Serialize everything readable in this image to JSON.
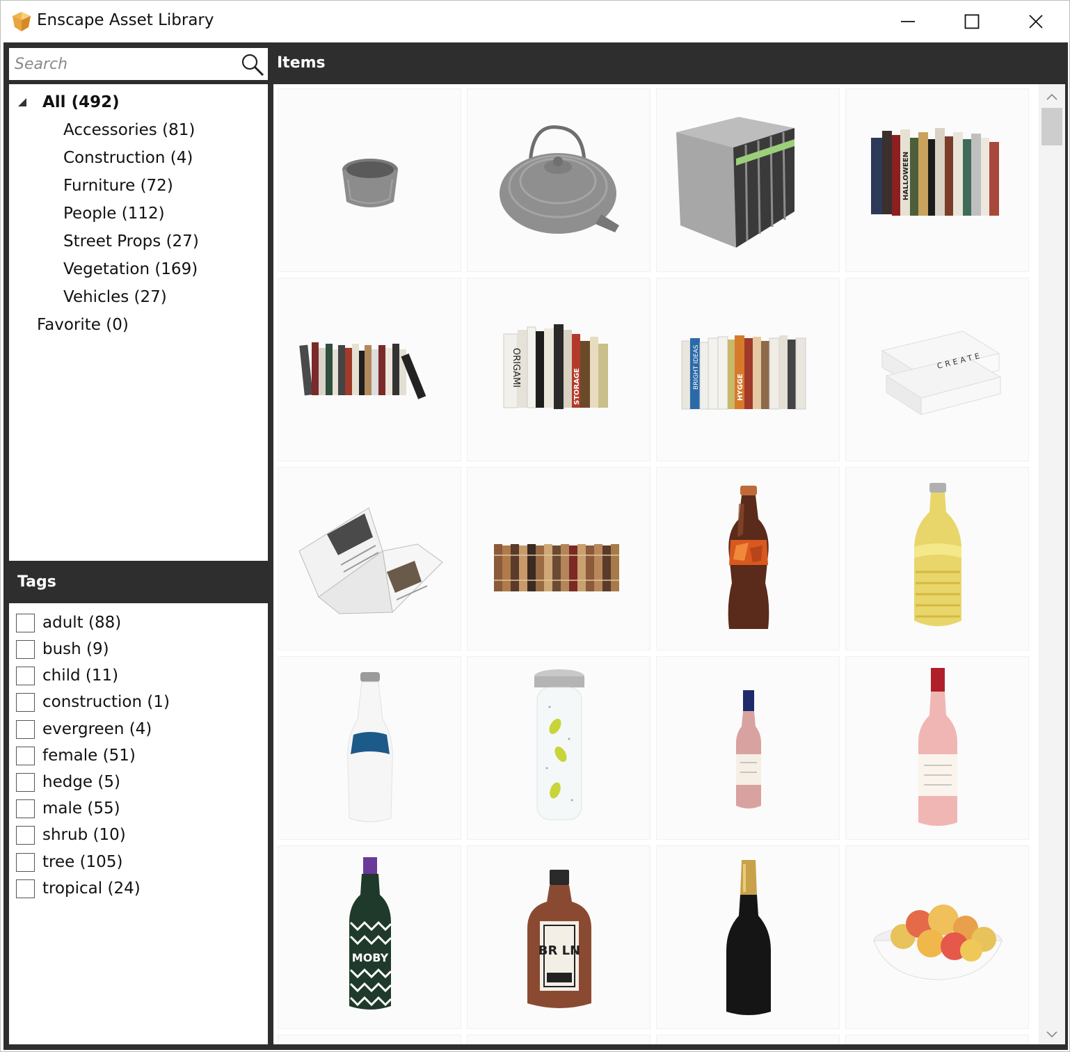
{
  "window": {
    "title": "Enscape Asset Library"
  },
  "search": {
    "placeholder": "Search"
  },
  "tree": {
    "root_label": "All (492)",
    "categories": [
      "Accessories (81)",
      "Construction (4)",
      "Furniture (72)",
      "People (112)",
      "Street Props (27)",
      "Vegetation (169)",
      "Vehicles (27)"
    ],
    "favorite_label": "Favorite (0)"
  },
  "tags": {
    "header": "Tags",
    "items": [
      "adult (88)",
      "bush (9)",
      "child (11)",
      "construction (1)",
      "evergreen (4)",
      "female (51)",
      "hedge (5)",
      "male (55)",
      "shrub (10)",
      "tree (105)",
      "tropical (24)"
    ]
  },
  "items": {
    "header": "Items",
    "thumbnails": [
      "metal-cup-icon",
      "cast-iron-teapot-icon",
      "binders-icon",
      "books-row-icon",
      "books-row-icon",
      "books-row-icon",
      "books-row-icon",
      "book-stack-icon",
      "open-magazine-icon",
      "books-row-icon",
      "cola-bottle-icon",
      "yellow-bottle-icon",
      "white-bottle-icon",
      "lemon-water-bottle-icon",
      "rose-wine-bottle-icon",
      "rose-wine-bottle-icon",
      "zigzag-bottle-icon",
      "brown-liquor-bottle-icon",
      "champagne-bottle-icon",
      "fruit-bowl-icon"
    ],
    "embedded_text": {
      "books_spine_1": "HALLOWEEN",
      "books_spine_2": "ORIGAMI",
      "books_spine_3": "STORAGE",
      "books_spine_4": "HYGGE",
      "books_spine_5": "BRIGHT IDEAS",
      "book_stack": "CREATE",
      "bottle_label_1": "MOBY",
      "bottle_label_2": "BR LN"
    }
  },
  "colors": {
    "panel_dark": "#2e2e2e",
    "accent_gold": "#e8a33a"
  }
}
